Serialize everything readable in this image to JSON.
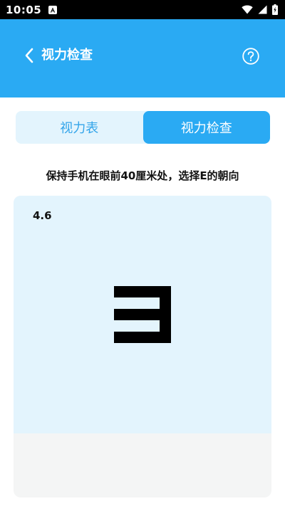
{
  "status_bar": {
    "time": "10:05",
    "icons": [
      "notification-a-icon",
      "wifi-icon",
      "signal-icon",
      "battery-charging-icon"
    ]
  },
  "app_bar": {
    "title": "视力检查",
    "back_icon": "chevron-left-icon",
    "help_icon": "help-circle-icon",
    "color": "#2aaaf3"
  },
  "tabs": [
    {
      "label": "视力表",
      "active": false
    },
    {
      "label": "视力检查",
      "active": true
    }
  ],
  "instruction": "保持手机在眼前40厘米处，选择E的朝向",
  "test_card": {
    "level": "4.6",
    "symbol": "E",
    "symbol_direction": "left"
  },
  "colors": {
    "accent": "#2aaaf3",
    "tab_background": "#e3f4fd",
    "card_background": "#e3f4fd",
    "card_bottom": "#f4f5f5"
  }
}
